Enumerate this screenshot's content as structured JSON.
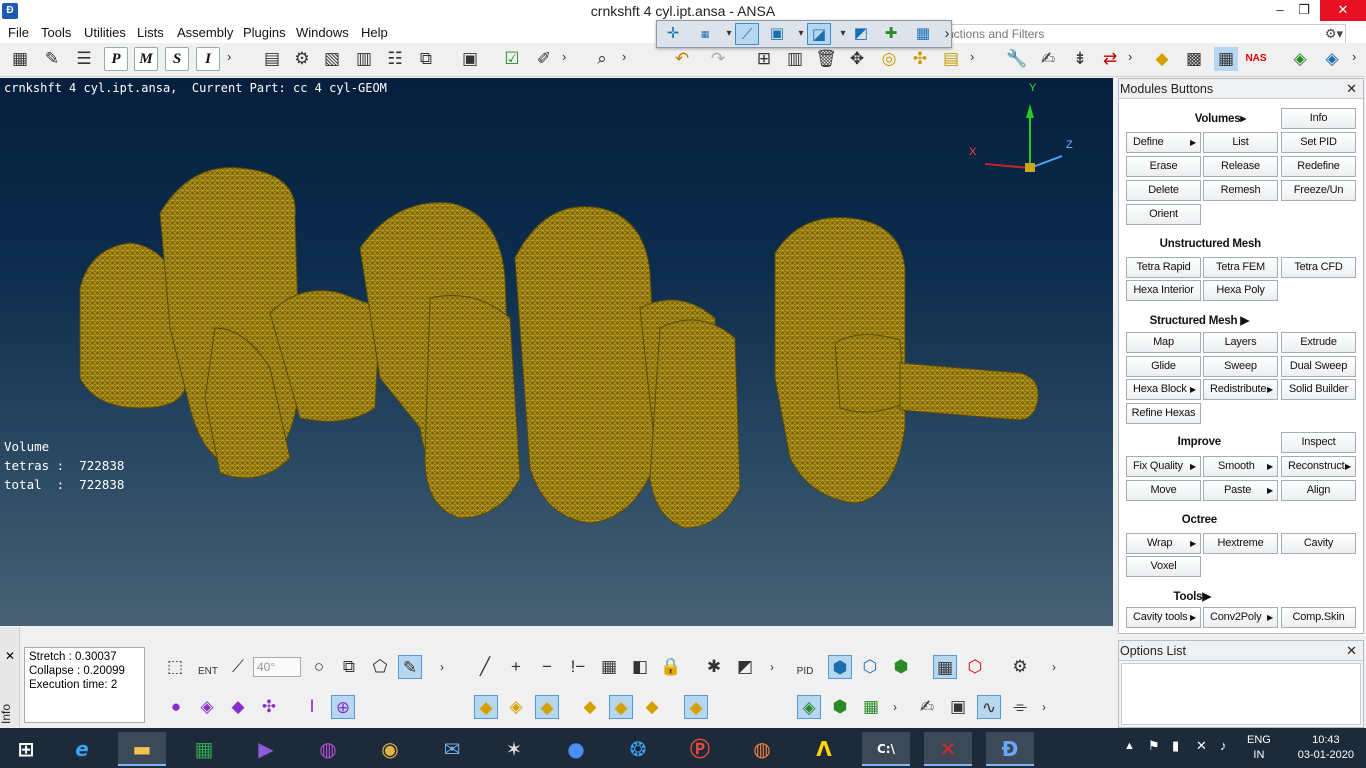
{
  "window": {
    "title": "crnkshft 4 cyl.ipt.ansa - ANSA",
    "app_icon": "Ansa",
    "minimize": "–",
    "maximize": "❐",
    "close": "✕"
  },
  "menu": [
    "File",
    "Tools",
    "Utilities",
    "Lists",
    "Assembly",
    "Plugins",
    "Windows",
    "Help"
  ],
  "search": {
    "placeholder": "nctions and Filters",
    "icon": "gear-icon"
  },
  "toolbar": {
    "letter_buttons": [
      "P",
      "M",
      "S",
      "I"
    ],
    "overflow": "›"
  },
  "viewport": {
    "header": "crnkshft 4 cyl.ipt.ansa,  Current Part: cc 4 cyl-GEOM",
    "stats": {
      "heading": "Volume",
      "tetras": "tetras :  722838",
      "total": "total  :  722838"
    },
    "triad": {
      "x": "X",
      "y": "Y",
      "z": "Z"
    },
    "model_color": "#7a6410",
    "model_edge_color": "#c9a81c"
  },
  "modules": {
    "title": "Modules Buttons",
    "close": "✕",
    "sections": {
      "volumes": "Volumes▸",
      "unstructured": "Unstructured Mesh",
      "structured": "Structured Mesh ▶",
      "improve": "Improve",
      "octree": "Octree",
      "tools": "Tools▶"
    },
    "buttons": {
      "info": "Info",
      "define": "Define",
      "list": "List",
      "set_pid": "Set PID",
      "erase": "Erase",
      "release": "Release",
      "redefine": "Redefine",
      "delete": "Delete",
      "remesh": "Remesh",
      "freeze": "Freeze/Un",
      "orient": "Orient",
      "tetra_rapid": "Tetra Rapid",
      "tetra_fem": "Tetra FEM",
      "tetra_cfd": "Tetra CFD",
      "hexa_interior": "Hexa Interior",
      "hexa_poly": "Hexa Poly",
      "map": "Map",
      "layers": "Layers",
      "extrude": "Extrude",
      "glide": "Glide",
      "sweep": "Sweep",
      "dual_sweep": "Dual Sweep",
      "hexa_block": "Hexa Block",
      "redistribute": "Redistribute",
      "solid_builder": "Solid Builder",
      "refine_hexas": "Refine Hexas",
      "inspect": "Inspect",
      "fix_quality": "Fix Quality",
      "smooth": "Smooth",
      "reconstruct": "Reconstruct",
      "move": "Move",
      "paste": "Paste",
      "align": "Align",
      "wrap": "Wrap",
      "hextreme": "Hextreme",
      "cavity": "Cavity",
      "voxel": "Voxel",
      "cavity_tools": "Cavity tools",
      "conv2poly": "Conv2Poly",
      "comp_skin": "Comp.Skin"
    },
    "submenu_arrow": "▶"
  },
  "options": {
    "title": "Options List",
    "close": "✕"
  },
  "info": {
    "label": "Info",
    "close": "✕",
    "lines": [
      "Stretch : 0.30037",
      "Collapse : 0.20099",
      "Execution time: 2"
    ]
  },
  "bottom": {
    "ent_label": "ENT",
    "angle": "40°",
    "pid_label": "PID"
  },
  "taskbar": {
    "lang": "ENG",
    "region": "IN",
    "time": "10:43",
    "date": "03-01-2020"
  }
}
